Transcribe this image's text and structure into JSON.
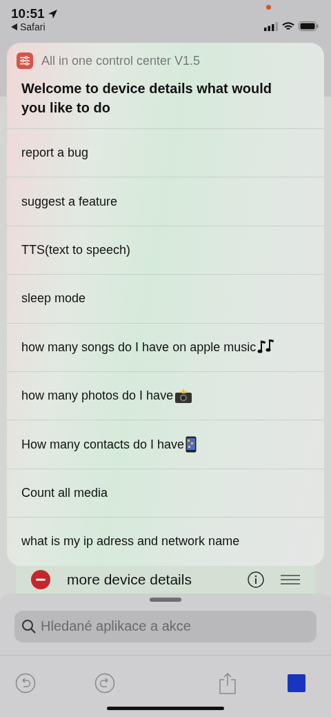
{
  "status_bar": {
    "time": "10:51",
    "back_label": "Safari"
  },
  "dialog": {
    "app_name": "All in one control center V1.5",
    "prompt": "Welcome to device details what would you like to do",
    "options": [
      {
        "label": "report a bug",
        "kind": "plain"
      },
      {
        "label": "suggest a feature",
        "kind": "plain"
      },
      {
        "label": "TTS(text to speech)",
        "kind": "plain"
      },
      {
        "label": "sleep mode",
        "kind": "plain"
      },
      {
        "label": "how many songs do I have on apple music",
        "kind": "notes"
      },
      {
        "label": "how many photos do I have",
        "kind": "camera"
      },
      {
        "label": "How many contacts do I have",
        "kind": "phone"
      },
      {
        "label": "Count all media",
        "kind": "plain"
      },
      {
        "label": "what is my ip adress and network name",
        "kind": "plain"
      }
    ]
  },
  "behind_action": {
    "title": "more device details"
  },
  "search": {
    "placeholder": "Hledané aplikace a akce"
  }
}
